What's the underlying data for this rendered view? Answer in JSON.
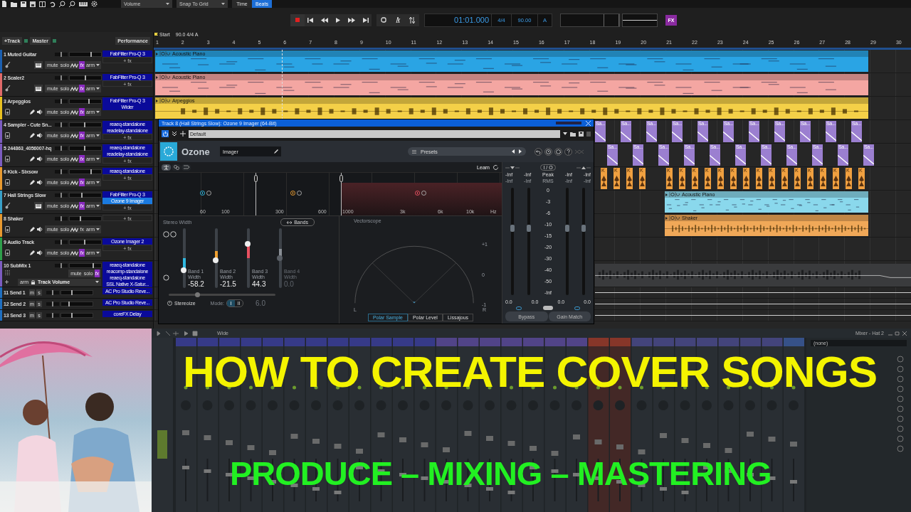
{
  "toolbar": {
    "dropdowns": [
      "Volume",
      "Snap To Grid"
    ],
    "time_modes": [
      {
        "label": "Time",
        "selected": false
      },
      {
        "label": "Beats",
        "selected": true
      }
    ]
  },
  "transport": {
    "time": "01:01.000",
    "signature": "4/4",
    "tempo": "90.00",
    "mode": "A",
    "fx": "FX"
  },
  "track_header": {
    "add_track": "+Track",
    "master": "Master",
    "performance": "Performance"
  },
  "tracks": [
    {
      "number": "1",
      "name": "Muted Guitar",
      "kind": "instrument",
      "color": "#1b5fb0",
      "level": 0.65,
      "pan": {
        "level": 0.5
      },
      "fx_on": true,
      "buttons": [
        "mute",
        "solo",
        "fx",
        "arm"
      ],
      "plugins": [
        {
          "name": "FabFilter Pro-Q 3",
          "selected": false
        }
      ],
      "add_fx": "+ fx"
    },
    {
      "number": "2",
      "name": "Scaler2",
      "kind": "instrument",
      "color": "#e06a6a",
      "level": 0.48,
      "pan": {
        "level": 0.5
      },
      "fx_on": true,
      "buttons": [
        "mute",
        "solo",
        "fx",
        "arm"
      ],
      "plugins": [
        {
          "name": "FabFilter Pro-Q 3",
          "selected": false
        }
      ],
      "add_fx": "+ fx"
    },
    {
      "number": "3",
      "name": "Arpeggios",
      "kind": "audio",
      "color": "#e8c020",
      "level": 0.58,
      "pan": {
        "level": 0.5
      },
      "fx_on": true,
      "buttons": [
        "mute",
        "solo",
        "fx",
        "arm"
      ],
      "plugins": [
        {
          "name": "FabFilter Pro-Q 3",
          "selected": false
        },
        {
          "name": "Wider",
          "selected": false
        }
      ]
    },
    {
      "number": "4",
      "name": "Sampler - Cute Sn...",
      "kind": "audio",
      "color": "#7c5cc0",
      "level": 0.45,
      "pan": {
        "level": 0.5
      },
      "fx_on": true,
      "buttons": [
        "mute",
        "solo",
        "fx",
        "arm"
      ],
      "plugins": [
        {
          "name": "reaeq-standalone",
          "selected": false
        },
        {
          "name": "readelay-standalone",
          "selected": false
        }
      ],
      "add_fx": "+ fx"
    },
    {
      "number": "5",
      "name": "244863_4056007-hq",
      "kind": "audio",
      "color": "#7c5cc0",
      "level": 0.45,
      "pan": {
        "level": 0.5
      },
      "fx_on": true,
      "buttons": [
        "mute",
        "solo",
        "fx",
        "arm"
      ],
      "plugins": [
        {
          "name": "reaeq-standalone",
          "selected": false
        },
        {
          "name": "readelay-standalone",
          "selected": false
        }
      ],
      "add_fx": "+ fx"
    },
    {
      "number": "6",
      "name": "Kick - Sixsow",
      "kind": "audio",
      "color": "#e89a30",
      "level": 0.65,
      "pan": {
        "level": 0.5
      },
      "fx_on": true,
      "buttons": [
        "mute",
        "solo",
        "fx",
        "arm"
      ],
      "plugins": [
        {
          "name": "reaeq-standalone",
          "selected": false
        }
      ],
      "add_fx": "+ fx"
    },
    {
      "number": "7",
      "name": "Hall Strings Slow",
      "kind": "instrument",
      "color": "#39a0c8",
      "level": 0.36,
      "pan": {
        "level": 0.5
      },
      "fx_on": true,
      "buttons": [
        "mute",
        "solo",
        "fx",
        "arm"
      ],
      "plugins": [
        {
          "name": "FabFilter Pro-Q 3",
          "selected": false
        },
        {
          "name": "Ozone 9 Imager",
          "selected": true
        }
      ],
      "add_fx": "+ fx"
    },
    {
      "number": "8",
      "name": "Shaker",
      "kind": "audio",
      "color": "#e89a30",
      "level": 0.31,
      "pan": {
        "level": 0.5
      },
      "fx_on": false,
      "buttons": [
        "mute",
        "solo",
        "fx",
        "arm"
      ],
      "add_fx": "+ fx"
    },
    {
      "number": "9",
      "name": "Audio Track",
      "kind": "audio",
      "color": "#2e9e4a",
      "level": 0.45,
      "pan": {
        "level": 0.5
      },
      "fx_on": true,
      "buttons": [
        "mute",
        "solo",
        "fx",
        "arm"
      ],
      "plugins": [
        {
          "name": "Ozone Imager 2",
          "selected": false
        }
      ],
      "add_fx": "+ fx"
    },
    {
      "number": "10",
      "name": "SubMix 1",
      "kind": "bus",
      "color": "#7c5cc0",
      "level": 0.72,
      "pan": {
        "level": 0.5
      },
      "fx_on": true,
      "buttons": [
        "mute",
        "solo",
        "fx"
      ],
      "arm": "arm",
      "automation": "Track Volume",
      "plugins": [
        {
          "name": "reaeq-standalone",
          "selected": false
        },
        {
          "name": "reacomp-standalone",
          "selected": false
        },
        {
          "name": "reaeq-standalone",
          "selected": false
        },
        {
          "name": "SSL Native X-Satur...",
          "selected": false
        }
      ]
    },
    {
      "number": "11",
      "name": "Send 1",
      "kind": "send",
      "color": "#1f6fc0",
      "level": 0.31,
      "pan": {
        "level": 0.5
      },
      "buttons": [
        "m",
        "s"
      ],
      "plugins": [
        {
          "name": "AC Pro Studio Reve...",
          "selected": false
        }
      ]
    },
    {
      "number": "12",
      "name": "Send 2",
      "kind": "send",
      "color": "#1f6fc0",
      "level": 0.22,
      "pan": {
        "level": 0.5
      },
      "buttons": [
        "m",
        "s"
      ],
      "plugins": [
        {
          "name": "AC Pro Studio Reve...",
          "selected": false
        }
      ]
    },
    {
      "number": "13",
      "name": "Send 3",
      "kind": "send",
      "color": "#1f6fc0",
      "level": 0.31,
      "pan": {
        "level": 0.5
      },
      "buttons": [
        "m",
        "s"
      ],
      "plugins": [
        {
          "name": "coreFX Delay",
          "selected": false
        }
      ]
    }
  ],
  "ruler": {
    "start_marker": "Start",
    "tempo_marker": "90.0 4/4 A",
    "bars": [
      "1",
      "2",
      "3",
      "4",
      "5",
      "6",
      "7",
      "8",
      "9",
      "10",
      "11",
      "12",
      "13",
      "14",
      "15",
      "16",
      "17",
      "18",
      "19",
      "20",
      "21",
      "22",
      "23",
      "24",
      "25",
      "26",
      "27",
      "28",
      "29",
      "30"
    ]
  },
  "lanes": [
    {
      "kind": "midi_clip",
      "starts_late": false,
      "label": "Acoustic Piano",
      "color": "#2aa4e4"
    },
    {
      "kind": "midi_clip",
      "starts_late": false,
      "label": "Acoustic Piano",
      "color": "#f4a6a2"
    },
    {
      "kind": "audio_clip",
      "starts_late": false,
      "label": "Arpeggios",
      "color": "#f4d048"
    },
    {
      "kind": "pattern",
      "color": "#9b7fd0",
      "clips": [
        "Sa...",
        "Sa...",
        "Sa...",
        "Sa...",
        "Sa...",
        "Sa...",
        "Sa...",
        "Sa...",
        "Sa...",
        "Sa...",
        "Sa..."
      ]
    },
    {
      "kind": "pattern",
      "color": "#9b7fd0",
      "clips": [
        "Sa...",
        "Sa...",
        "Sa...",
        "Sa...",
        "Sa...",
        "Sa...",
        "Sa...",
        "Sa...",
        "Sa...",
        "Sa...",
        "Sa..."
      ]
    },
    {
      "kind": "hits",
      "color": "#f0a040",
      "clips": [
        "K",
        "K",
        "K",
        "K",
        "K",
        "K",
        "K",
        "K",
        "K",
        "K",
        "K",
        "K",
        "K",
        "K",
        "K",
        "K",
        "K",
        "K",
        "K",
        "K"
      ]
    },
    {
      "kind": "midi_clip",
      "starts_late": true,
      "label": "Acoustic Piano",
      "color": "#8ad8ec"
    },
    {
      "kind": "audio_clip",
      "starts_late": true,
      "label": "Shaker",
      "color": "#f0a858"
    },
    {
      "kind": "empty"
    },
    {
      "kind": "waveform"
    },
    {
      "kind": "automation"
    },
    {
      "kind": "automation"
    },
    {
      "kind": "automation"
    }
  ],
  "plugin_window": {
    "title": "Track 8 (Hall Strings Slow): Ozone 9 Imager (64-Bit)",
    "preset": "Default",
    "product": "Ozone",
    "module": "Imager",
    "presets": "Presets",
    "learn": "Learn",
    "view_modes": [
      {
        "selected": true
      },
      {
        "selected": false
      },
      {
        "selected": false
      }
    ],
    "frequencies": [
      "60",
      "100",
      "300",
      "600",
      "1000",
      "3k",
      "6k",
      "10k",
      "Hz"
    ],
    "bands_button": "Bands",
    "stereo_width": "Stereo Width",
    "bands": [
      {
        "label": "Band 1 Width",
        "value": "-58.2",
        "level": 0.3,
        "color": "#2fb8e0",
        "disabled": false
      },
      {
        "label": "Band 2 Width",
        "value": "-21.5",
        "level": 0.47,
        "color": "#f0a030",
        "disabled": false
      },
      {
        "label": "Band 3 Width",
        "value": "44.3",
        "level": 0.74,
        "color": "#e85060",
        "disabled": false
      },
      {
        "label": "Band 4 Width",
        "value": "0.0",
        "level": 0.5,
        "color": "#8a8f96",
        "disabled": true
      }
    ],
    "stereoize": "Stereoize",
    "stereoize_level": {
      "level": 0.27
    },
    "stereoize_amount": "6.0",
    "mode_label": "Mode:",
    "modes": [
      {
        "label": "I",
        "selected": true
      },
      {
        "label": "II",
        "selected": false
      }
    ],
    "vectorscope": {
      "title": "Vectorscope",
      "scale": [
        "+1",
        "0",
        "-1"
      ],
      "left": "L",
      "right": "R"
    },
    "scope_tabs": [
      {
        "label": "Polar Sample",
        "selected": true
      },
      {
        "label": "Polar Level",
        "selected": false
      },
      {
        "label": "Lissajous",
        "selected": false
      }
    ],
    "meters": {
      "io": "I / O",
      "peak": "Peak",
      "rms": "RMS",
      "peak_readings": [
        "-Inf",
        "-Inf",
        "-Inf",
        "-Inf"
      ],
      "rms_readings": [
        "-Inf",
        "-Inf",
        "-Inf",
        "-Inf"
      ],
      "scale": [
        "0",
        "-3",
        "-6",
        "-10",
        "-15",
        "-20",
        "-30",
        "-40",
        "-50",
        "-Inf"
      ],
      "faders": [
        {
          "level": 0.62
        },
        {
          "level": 0.62
        },
        {
          "level": 0.62
        },
        {
          "level": 0.62
        }
      ],
      "gains": [
        "0.0",
        "0.0",
        "0.0",
        "0.0"
      ],
      "buttons": [
        "Bypass",
        "Gain Match"
      ]
    }
  },
  "mixer": {
    "preset": "Wide",
    "window_title": "Mixer - Hat 2",
    "insert_slot": "(none)"
  },
  "headline": {
    "title": "HOW TO CREATE COVER SONGS",
    "subtitle": "PRODUCE – MIXING – MASTERING"
  }
}
